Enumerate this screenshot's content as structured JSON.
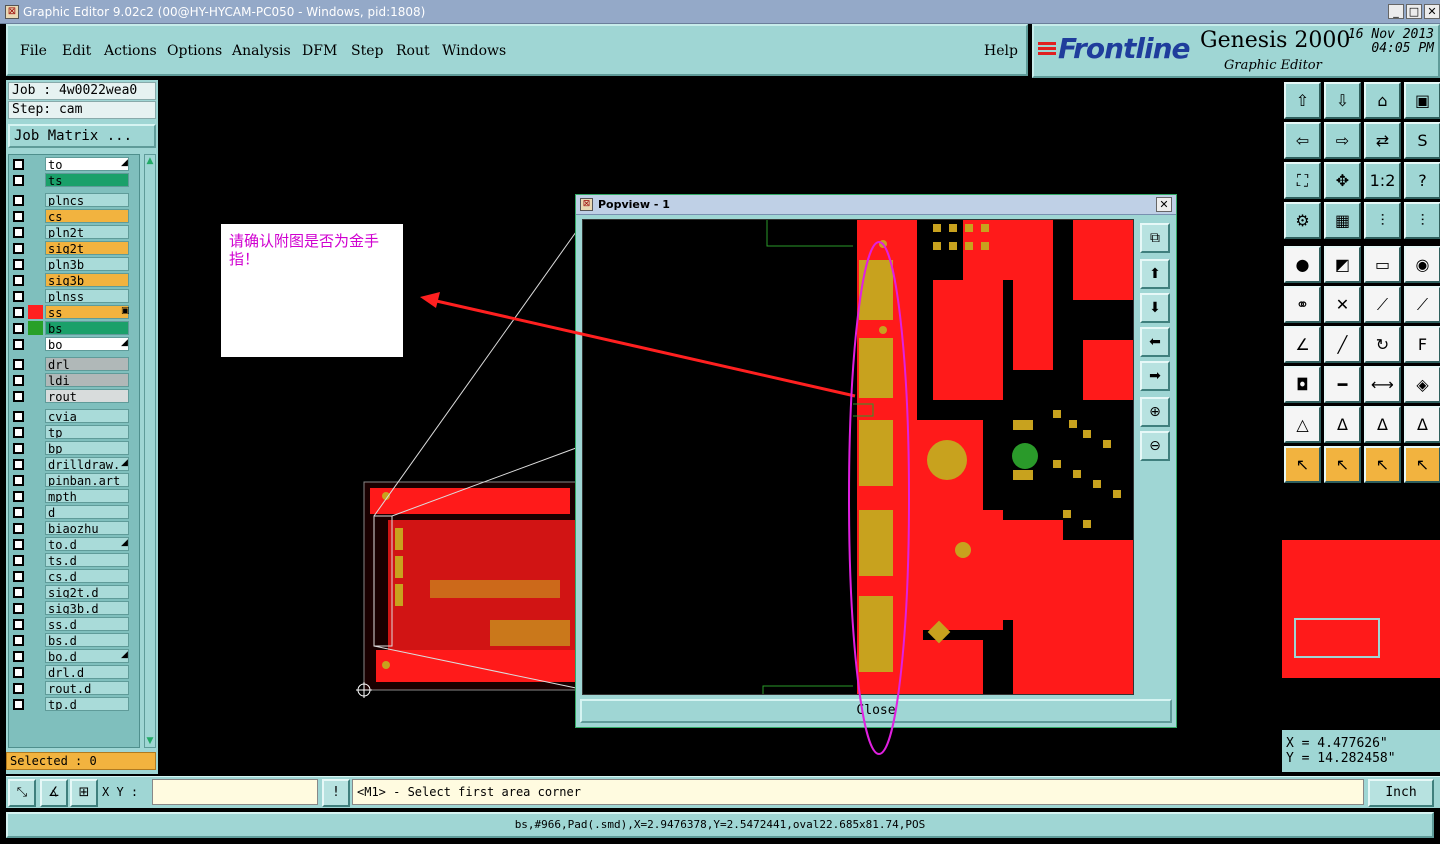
{
  "window": {
    "title": "Graphic Editor 9.02c2 (00@HY-HYCAM-PC050 - Windows, pid:1808)",
    "minimize": "_",
    "maximize": "□",
    "close": "✕"
  },
  "menu": {
    "items": [
      "File",
      "Edit",
      "Actions",
      "Options",
      "Analysis",
      "DFM",
      "Step",
      "Rout",
      "Windows"
    ],
    "help": "Help"
  },
  "logo": {
    "brand": "Frontline",
    "product": "Genesis 2000",
    "subtitle": "Graphic Editor",
    "date": "16 Nov 2013",
    "time": "04:05 PM"
  },
  "job": {
    "job_label": "Job : 4w0022wea0",
    "step_label": "Step: cam",
    "matrix_button": "Job Matrix ...",
    "selected": "Selected : 0"
  },
  "layers": [
    {
      "name": "to",
      "bg": "#ffffff",
      "sw": "",
      "mark": "◢"
    },
    {
      "name": "ts",
      "bg": "#1aa06a",
      "sw": "",
      "mark": ""
    },
    {
      "name": "plncs",
      "bg": "#a9dbd9",
      "sw": "",
      "mark": ""
    },
    {
      "name": "cs",
      "bg": "#f2b33f",
      "sw": "",
      "mark": ""
    },
    {
      "name": "pln2t",
      "bg": "#a9dbd9",
      "sw": "",
      "mark": ""
    },
    {
      "name": "sig2t",
      "bg": "#f2b33f",
      "sw": "",
      "mark": ""
    },
    {
      "name": "pln3b",
      "bg": "#a9dbd9",
      "sw": "",
      "mark": ""
    },
    {
      "name": "sig3b",
      "bg": "#f2b33f",
      "sw": "",
      "mark": ""
    },
    {
      "name": "plnss",
      "bg": "#a9dbd9",
      "sw": "",
      "mark": ""
    },
    {
      "name": "ss",
      "bg": "#f2b33f",
      "sw": "#ff2020",
      "mark": "▣"
    },
    {
      "name": "bs",
      "bg": "#1aa06a",
      "sw": "#28a028",
      "mark": ""
    },
    {
      "name": "bo",
      "bg": "#ffffff",
      "sw": "",
      "mark": "◢"
    },
    {
      "name": "drl",
      "bg": "#b0b8b8",
      "sw": "",
      "mark": ""
    },
    {
      "name": "ldi",
      "bg": "#b0b8b8",
      "sw": "",
      "mark": ""
    },
    {
      "name": "rout",
      "bg": "#d8dcdc",
      "sw": "",
      "mark": ""
    },
    {
      "name": "cvia",
      "bg": "#a9dbd9",
      "sw": "",
      "mark": ""
    },
    {
      "name": "tp",
      "bg": "#a9dbd9",
      "sw": "",
      "mark": ""
    },
    {
      "name": "bp",
      "bg": "#a9dbd9",
      "sw": "",
      "mark": ""
    },
    {
      "name": "drilldraw.",
      "bg": "#a9dbd9",
      "sw": "",
      "mark": "◢"
    },
    {
      "name": "pinban.art",
      "bg": "#a9dbd9",
      "sw": "",
      "mark": ""
    },
    {
      "name": "mpth",
      "bg": "#a9dbd9",
      "sw": "",
      "mark": ""
    },
    {
      "name": "d",
      "bg": "#a9dbd9",
      "sw": "",
      "mark": ""
    },
    {
      "name": "biaozhu",
      "bg": "#a9dbd9",
      "sw": "",
      "mark": ""
    },
    {
      "name": "to.d",
      "bg": "#a9dbd9",
      "sw": "",
      "mark": "◢"
    },
    {
      "name": "ts.d",
      "bg": "#a9dbd9",
      "sw": "",
      "mark": ""
    },
    {
      "name": "cs.d",
      "bg": "#a9dbd9",
      "sw": "",
      "mark": ""
    },
    {
      "name": "sig2t.d",
      "bg": "#a9dbd9",
      "sw": "",
      "mark": ""
    },
    {
      "name": "sig3b.d",
      "bg": "#a9dbd9",
      "sw": "",
      "mark": ""
    },
    {
      "name": "ss.d",
      "bg": "#a9dbd9",
      "sw": "",
      "mark": ""
    },
    {
      "name": "bs.d",
      "bg": "#a9dbd9",
      "sw": "",
      "mark": ""
    },
    {
      "name": "bo.d",
      "bg": "#a9dbd9",
      "sw": "",
      "mark": "◢"
    },
    {
      "name": "drl.d",
      "bg": "#a9dbd9",
      "sw": "",
      "mark": ""
    },
    {
      "name": "rout.d",
      "bg": "#a9dbd9",
      "sw": "",
      "mark": ""
    },
    {
      "name": "tp.d",
      "bg": "#a9dbd9",
      "sw": "",
      "mark": ""
    }
  ],
  "annotation": {
    "note": "请确认附图是否为金手指！"
  },
  "popview": {
    "title": "Popview - 1",
    "close_x": "✕",
    "close_button": "Close"
  },
  "coords": {
    "x": "X =  4.477626\"",
    "y": "Y = 14.282458\""
  },
  "command": {
    "xy_label": "X Y :",
    "xy_value": "",
    "bang": "!",
    "message": "<M1> - Select first area corner",
    "unit": "Inch"
  },
  "status": "bs,#966,Pad(.smd),X=2.9476378,Y=2.5472441,oval22.685x81.74,POS",
  "colors": {
    "panel_teal": "#9fd6d4",
    "copper_red": "#ff1a1a",
    "pad_gold": "#c8a21e",
    "accent_orange": "#f2b33f",
    "annotation_magenta": "#d000d0"
  }
}
